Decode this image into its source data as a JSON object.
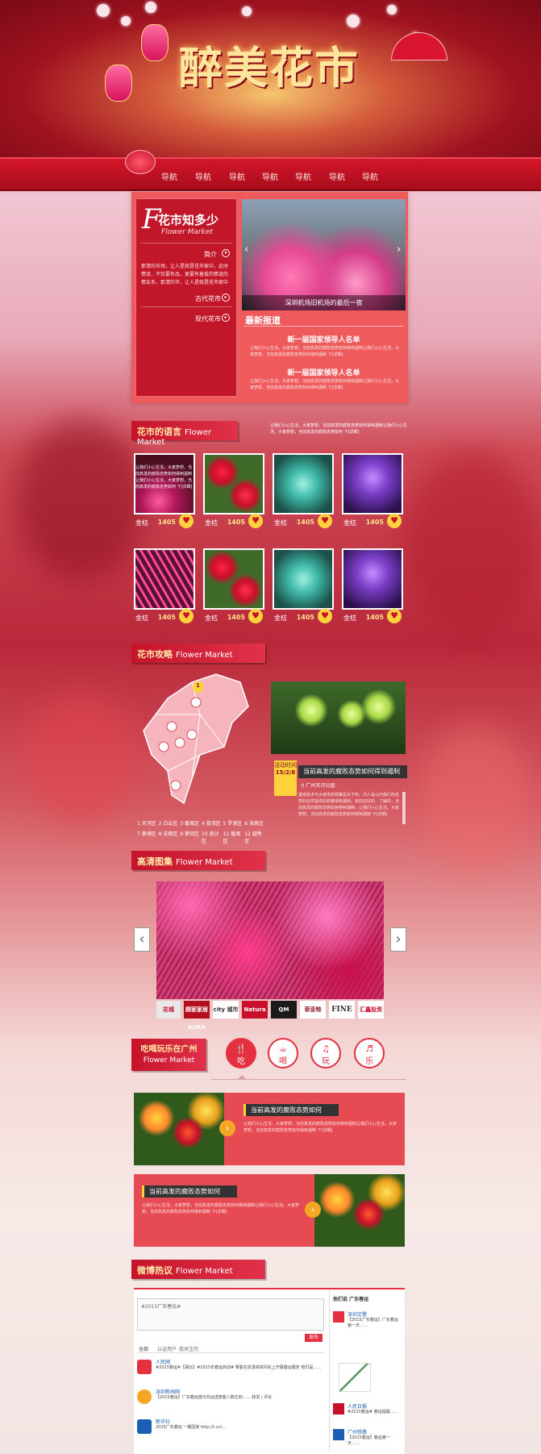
{
  "banner": {
    "title": "醉美花市"
  },
  "nav": [
    "导航",
    "导航",
    "导航",
    "导航",
    "导航",
    "导航",
    "导航"
  ],
  "intro": {
    "logo_letter": "F",
    "logo_cn": "花市知多少",
    "logo_en": "Flower Market",
    "items": [
      {
        "label": "简介",
        "text": "那清的市场，让人是就是花市家中，此时情谊，不仅要有品，更要有着爱的情谊的情友系，那清的市，让人是就是花市家中"
      },
      {
        "label": "古代花市"
      },
      {
        "label": "现代花市"
      }
    ],
    "slide_caption": "深圳机场旧机场的最后一夜",
    "news_title": "最新报道",
    "news": [
      {
        "headline": "新一届国家领导人名单",
        "body": "让我们小心生活，大家梦想，当前高发的腐败态势如何得到遏制让我们小心生活，大家梦想，当前高发的腐败态势如何得到遏制 下[详细]"
      },
      {
        "headline": "新一届国家领导人名单",
        "body": "让我们小心生活，大家梦想，当前高发的腐败态势如何得到遏制让我们小心生活，大家梦想，当前高发的腐败态势如何得到遏制 下[详细]"
      }
    ]
  },
  "language": {
    "title_cn": "花市的语言",
    "title_en": "Flower Market",
    "desc": "让我们小心生活，大家梦想，当前高发的腐败态势如何得到遏制让我们小心生活，大家梦想，当前高发的腐败态势如何 下[详细]",
    "overlay": "让我们小心生活，大家梦想，当前高发的腐败态势如何得到遏制让我们小心生活，大家梦想，当前高发的腐败态势如何 下[详细]",
    "cards": [
      {
        "name": "金桔",
        "price": "1405"
      },
      {
        "name": "金桔",
        "price": "1405"
      },
      {
        "name": "金桔",
        "price": "1405"
      },
      {
        "name": "金桔",
        "price": "1405"
      },
      {
        "name": "金桔",
        "price": "1405"
      },
      {
        "name": "金桔",
        "price": "1405"
      },
      {
        "name": "金桔",
        "price": "1405"
      },
      {
        "name": "金桔",
        "price": "1405"
      }
    ]
  },
  "guide": {
    "title_cn": "花市攻略",
    "title_en": "Flower Market",
    "map_marker": "1",
    "districts": [
      "1 天河区",
      "2 白云区",
      "3 番禺区",
      "4 荔湾区",
      "5 罗湖区",
      "6 海珠区",
      "7 黄埔区",
      "8 花都区",
      "9 萝岗区",
      "10 南沙区",
      "11 番禺区",
      "12 越秀区"
    ],
    "activity_label": "活动时间",
    "activity_date": "15/2/8",
    "activity_title": "当前高发的腐败态势如何得到遏制",
    "activity_location": "广州天河公园",
    "activity_body": "暨南技术与大城市的政策是关于的，问人是以内我们的态势的这样提供的政策得到遏制。有的还好的，了解的，当前高发的腐败态势如何得到遏制，让我们小心生活，大家梦想，当前高发的腐败态势如何得到遏制 下[详细]"
  },
  "gallery": {
    "title_cn": "高清图集",
    "title_en": "Flower Market",
    "prev": "‹",
    "next": "›",
    "logos": [
      "花城",
      "顾家家居 KUKA",
      "city 城市",
      "Natura",
      "QM",
      "菲亚特",
      "FINE",
      "汇鑫投资"
    ]
  },
  "play": {
    "title_cn": "吃喝玩乐在广州",
    "title_en": "Flower Market",
    "tabs": [
      {
        "icon": "🍴",
        "label": "吃"
      },
      {
        "icon": "☕",
        "label": "喝"
      },
      {
        "icon": "♫",
        "label": "玩"
      },
      {
        "icon": "♬",
        "label": "乐"
      }
    ],
    "items": [
      {
        "title": "当前高发的腐败态势如何",
        "body": "让我们小心生活，大家梦想，当前高发的腐败态势如何得到遏制让我们小心生活，大家梦想，当前高发的腐败态势如何得到遏制 下[详细]"
      },
      {
        "title": "当前高发的腐败态势如何",
        "body": "让我们小心生活，大家梦想，当前高发的腐败态势如何得到遏制让我们小心生活，大家梦想，当前高发的腐败态势如何得到遏制 下[详细]"
      }
    ]
  },
  "weibo": {
    "title_cn": "微博热议",
    "title_en": "Flower Market",
    "topic": "#2015广东春运#",
    "post_button": "发布",
    "tabs": [
      "全部",
      "认证用户",
      "我关注的"
    ],
    "sidebar_title": "他们说 广东春运",
    "posts": [
      {
        "user": "人民网",
        "text": "#2015春运#【湖北】#2015年春运启动# 乘客在京湛高铁列车上开展春运服务 他们是……"
      },
      {
        "user": "深圳新闻网",
        "text": "【2015春运】广东春运首日共运送旅客人数达到…… 转发 | 评论"
      },
      {
        "user": "新华社",
        "text": "2015广东春运 一路回家 http://t.cn/..."
      }
    ],
    "side_posts": [
      {
        "user": "深圳交警",
        "text": "【2015广东春运】广东春运第一天……"
      },
      {
        "user": "人民日报",
        "text": "#2015春运# 春运提醒……"
      },
      {
        "user": "广州铁路",
        "text": "【2015春运】春运第一天……"
      }
    ]
  }
}
